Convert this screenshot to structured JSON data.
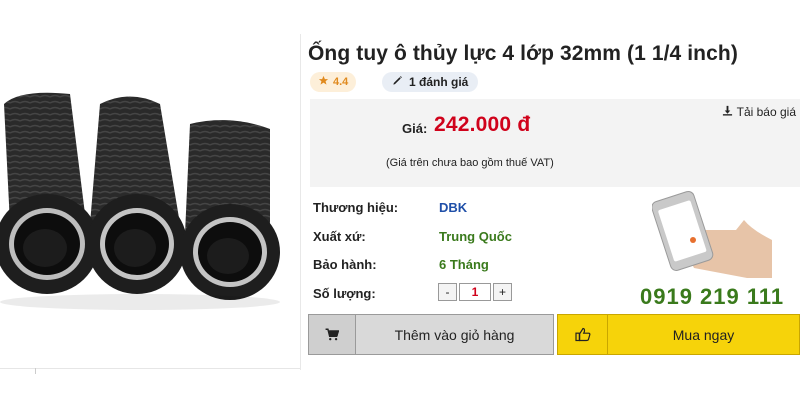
{
  "product": {
    "title": "Ống tuy ô thủy lực 4 lớp 32mm (1 1/4 inch)",
    "rating": "4.4",
    "reviews": "1 đánh giá"
  },
  "price_box": {
    "download_label": "Tải báo giá",
    "price_label": "Giá:",
    "price": "242.000 đ",
    "vat_note": "(Giá trên chưa bao gồm thuế VAT)"
  },
  "specs": [
    {
      "label": "Thương hiệu:",
      "value": "DBK"
    },
    {
      "label": "Xuất xứ:",
      "value": "Trung Quốc"
    },
    {
      "label": "Bảo hành:",
      "value": "6 Tháng"
    },
    {
      "label": "Số lượng:",
      "value": ""
    }
  ],
  "quantity": {
    "minus": "-",
    "value": "1",
    "plus": "+"
  },
  "hotline": "0919 219 111",
  "actions": {
    "add_to_cart": "Thêm vào giỏ hàng",
    "buy_now": "Mua ngay"
  },
  "colors": {
    "price": "#d0021b",
    "brand_link": "#1f4fa8",
    "green_text": "#3a7a1c",
    "buy_button": "#f6d30a",
    "cart_button": "#d9d9d9"
  },
  "icons": {
    "rating": "star-icon",
    "reviews": "pencil-icon",
    "download": "download-icon",
    "cart": "cart-icon",
    "buy": "thumbs-up-icon",
    "phone": "smartphone-in-hand-illustration"
  }
}
